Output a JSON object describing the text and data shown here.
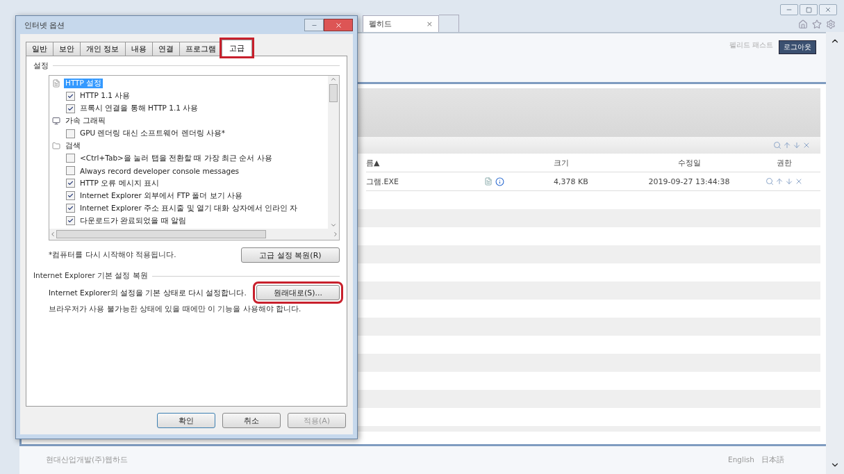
{
  "browser": {
    "tab": {
      "label": "펠히드",
      "close": "×"
    },
    "header_link": "펠리드 패스트",
    "logout_button": "로그아웃",
    "table": {
      "columns": [
        "름▲",
        "크기",
        "수정일",
        "권한"
      ],
      "rows": [
        {
          "name": "그램.EXE",
          "size": "4,378 KB",
          "modified": "2019-09-27 13:44:38"
        }
      ]
    },
    "footer": {
      "company": "현대산업개발(주)웹하드",
      "languages": [
        "English",
        "日本語"
      ]
    }
  },
  "dialog": {
    "title": "인터넷 옵션",
    "tabs": [
      {
        "label": "일반",
        "selected": false,
        "highlighted": false
      },
      {
        "label": "보안",
        "selected": false,
        "highlighted": false
      },
      {
        "label": "개인 정보",
        "selected": false,
        "highlighted": false
      },
      {
        "label": "내용",
        "selected": false,
        "highlighted": false
      },
      {
        "label": "연결",
        "selected": false,
        "highlighted": false
      },
      {
        "label": "프로그램",
        "selected": false,
        "highlighted": false
      },
      {
        "label": "고급",
        "selected": true,
        "highlighted": true
      }
    ],
    "settings_label": "설정",
    "settings": [
      {
        "label": "HTTP 설정",
        "selected": true,
        "children": [
          {
            "label": "HTTP 1.1 사용",
            "checked": true
          },
          {
            "label": "프록시 연결을 통해 HTTP 1.1 사용",
            "checked": true
          }
        ]
      },
      {
        "label": "가속 그래픽",
        "selected": false,
        "children": [
          {
            "label": "GPU 렌더링 대신 소프트웨어 렌더링 사용*",
            "checked": false
          }
        ]
      },
      {
        "label": "검색",
        "selected": false,
        "children": [
          {
            "label": "<Ctrl+Tab>을 눌러 탭을 전환할 때 가장 최근 순서 사용",
            "checked": false
          },
          {
            "label": "Always record developer console messages",
            "checked": false
          },
          {
            "label": "HTTP 오류 메시지 표시",
            "checked": true
          },
          {
            "label": "Internet Explorer 외부에서 FTP 폴더 보기 사용",
            "checked": true
          },
          {
            "label": "Internet Explorer 주소 표시줄 및 열기 대화 상자에서 인라인 자",
            "checked": true
          },
          {
            "label": "다운로드가 완료되었을 때 알림",
            "checked": true
          }
        ]
      }
    ],
    "restart_note": "*컴퓨터를 다시 시작해야 적용됩니다.",
    "restore_advanced_button": "고급 설정 복원(R)",
    "reset_group_label": "Internet Explorer 기본 설정 복원",
    "reset_description": "Internet Explorer의 설정을 기본 상태로 다시 설정합니다.",
    "reset_button": {
      "label": "원래대로(S)...",
      "highlighted": true
    },
    "reset_warning": "브라우저가 사용 불가능한 상태에 있을 때에만 이 기능을 사용해야 합니다.",
    "buttons": [
      {
        "label": "확인",
        "disabled": false,
        "default": true
      },
      {
        "label": "취소",
        "disabled": false,
        "default": false
      },
      {
        "label": "적용(A)",
        "disabled": true,
        "default": false
      }
    ]
  }
}
